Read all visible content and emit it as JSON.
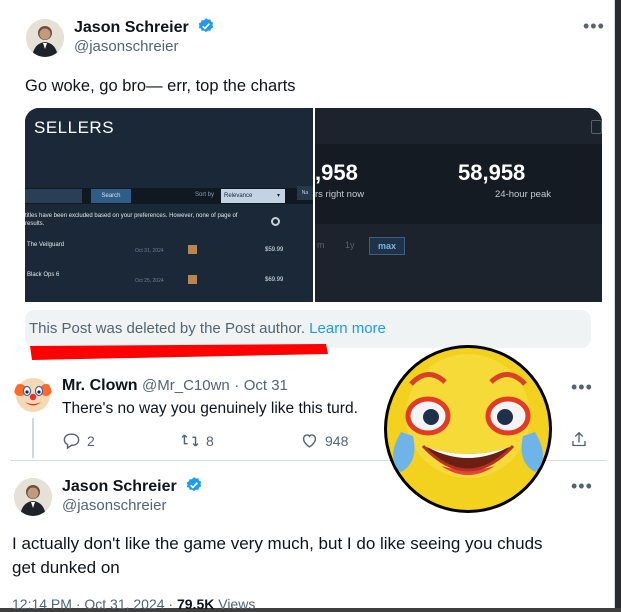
{
  "original_tweet": {
    "author_name": "Jason Schreier",
    "author_handle": "@jasonschreier",
    "verified_icon": "verified-badge-icon",
    "more_icon": "more-options-icon",
    "text": "Go woke, go bro— err, top the charts",
    "media": {
      "left_panel": {
        "title": "SELLERS",
        "search_button": "Search",
        "sort_label": "Sort by",
        "sort_value": "Relevance",
        "nar_label": "Na",
        "note": "titles have been excluded based on your preferences. However, none of page of results.",
        "rows": [
          {
            "title": "The Veilguard",
            "date": "Oct 31, 2024",
            "price": "$59.99"
          },
          {
            "title": "Black Ops 6",
            "date": "Oct 25, 2024",
            "price": "$69.99"
          }
        ]
      },
      "right_panel": {
        "current_value": ",958",
        "current_label": "rs right now",
        "peak_value": "58,958",
        "peak_label": "24-hour peak",
        "ranges": [
          "m",
          "1y",
          "max"
        ]
      }
    },
    "deleted_notice": "This Post was deleted by the Post author.",
    "learn_more": "Learn more"
  },
  "reply": {
    "author_name": "Mr. Clown",
    "author_handle": "@Mr_C10wn",
    "date": "Oct 31",
    "separator": "·",
    "avatar_icon": "clown-face-icon",
    "text": "There's no way you genuinely like this turd.",
    "replies": "2",
    "reposts": "8",
    "likes": "948"
  },
  "response_tweet": {
    "author_name": "Jason Schreier",
    "author_handle": "@jasonschreier",
    "text_line1": "I actually don't like the game very much, but I do like seeing you chuds",
    "text_line2": "get dunked on",
    "time": "12:14 PM · Oct 31, 2024 · ",
    "views": "79.5K",
    "views_label": " Views"
  },
  "overlay": {
    "emoji_icon": "laughing-crying-face-icon",
    "red_underline_color": "#ff0000"
  },
  "colors": {
    "verified": "#1d9bf0",
    "link": "#1d9bf0",
    "muted": "#536471",
    "steam_bg": "#1b2838"
  }
}
